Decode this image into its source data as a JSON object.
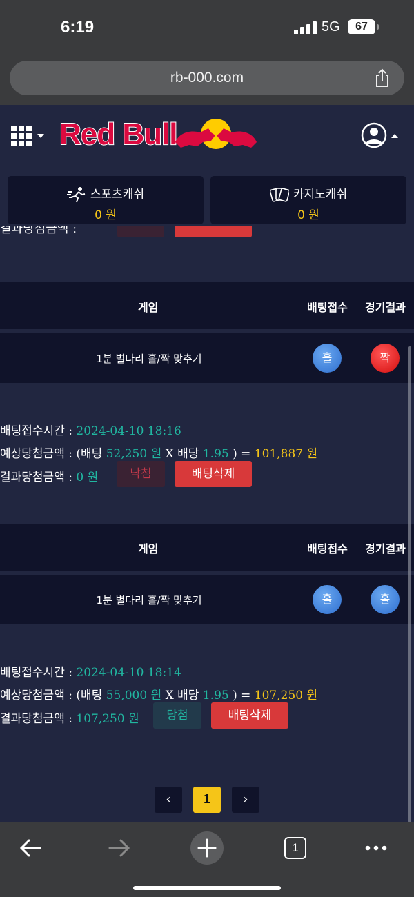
{
  "status": {
    "time": "6:19",
    "network": "5G",
    "battery": "67"
  },
  "browser": {
    "url": "rb-000.com",
    "tab_count": "1"
  },
  "header": {
    "logo": "Red Bull"
  },
  "cash": [
    {
      "label": "스포츠캐쉬",
      "value": "0 원"
    },
    {
      "label": "카지노캐쉬",
      "value": "0 원"
    }
  ],
  "columns": {
    "game": "게임",
    "bet_accept": "배팅접수",
    "result": "경기결과"
  },
  "bets": [
    {
      "game": "1분 별다리 홀/짝 맞추기",
      "bet_pick": "홀",
      "result_pick": "짝",
      "time_label": "배팅접수시간 :",
      "time": "2024-04-10 18:16",
      "expected_label": "예상당첨금액 : (배팅",
      "bet_amount": "52,250 원",
      "x_odds_label": "X 배당",
      "odds": "1.95",
      "eq": ") =",
      "expected": "101,887 원",
      "result_label": "결과당첨금액 :",
      "result_amount": "0 원",
      "status": "낙첨",
      "delete": "배팅삭제"
    },
    {
      "game": "1분 별다리 홀/짝 맞추기",
      "bet_pick": "홀",
      "result_pick": "홀",
      "time_label": "배팅접수시간 :",
      "time": "2024-04-10 18:14",
      "expected_label": "예상당첨금액 : (배팅",
      "bet_amount": "55,000 원",
      "x_odds_label": "X 배당",
      "odds": "1.95",
      "eq": ") =",
      "expected": "107,250 원",
      "result_label": "결과당첨금액 :",
      "result_amount": "107,250 원",
      "status": "당첨",
      "delete": "배팅삭제"
    }
  ],
  "pagination": {
    "prev": "‹",
    "current": "1",
    "next": "›"
  },
  "colors": {
    "bg": "#212640",
    "panel": "#10132a",
    "gold": "#f5c518",
    "teal": "#21b6a0",
    "red": "#d8393a"
  }
}
